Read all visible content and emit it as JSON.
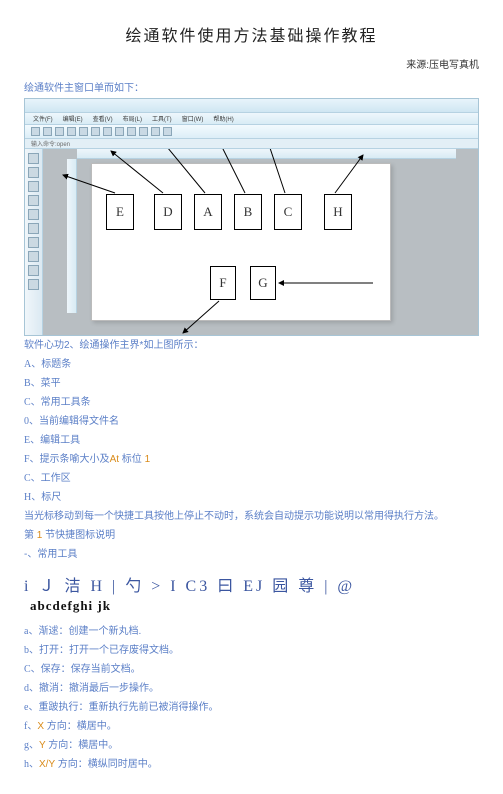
{
  "title": "绘通软件使用方法基础操作教程",
  "source_label": "来源:压电写真机",
  "lead": "绘通软件主窗口单而如下：",
  "screenshot": {
    "menu": [
      "文件(F)",
      "编辑(E)",
      "查看(V)",
      "布局(L)",
      "工具(T)",
      "窗口(W)",
      "帮助(H)"
    ],
    "status": "输入命令:open",
    "boxes": {
      "E": "E",
      "D": "D",
      "A": "A",
      "B": "B",
      "C": "C",
      "H": "H",
      "F": "F",
      "G": "G"
    }
  },
  "caption": "软件心功2、绘通操作主界*如上图所示：",
  "legend": [
    {
      "lbl": "A、",
      "txt": "标题条"
    },
    {
      "lbl": "B、",
      "txt": "菜平"
    },
    {
      "lbl": "C、",
      "txt": "常用工具条"
    },
    {
      "lbl": "0、",
      "txt": "当前编辑得文件名"
    },
    {
      "lbl": "E、",
      "txt": "编辑工具"
    },
    {
      "lbl": "F、",
      "txt": "提示条喻大小及",
      "orange": "At",
      "tail": " 标位 ",
      "orange2": "1"
    },
    {
      "lbl": "C、",
      "txt": "工作区"
    },
    {
      "lbl": "H、",
      "txt": "标尺"
    }
  ],
  "note1_a": "当光标移动到每一个快捷工具按他上停止不动时，系统会自动提示功能说明以常用得执行方法。",
  "note2_pre": "第 ",
  "note2_num": "1",
  "note2_post": " 节快捷图标说明",
  "note3": "-、常用工具",
  "glyphline": "i Ｊ 洁 H | 勺 > I  C3 曰 EJ 园 尊 | @",
  "glyphline2": "abcdefghi jk",
  "ops": [
    {
      "lbl": "a、",
      "txt": "渐逑：创建一个新丸档."
    },
    {
      "lbl": "b、",
      "txt": "打开：打开一个已存废得文档。"
    },
    {
      "lbl": "C、",
      "txt": "保存：保存当前文档。"
    },
    {
      "lbl": "d、",
      "txt": "撤消：撤消最后一步操作。"
    },
    {
      "lbl": "e、",
      "txt": "重跛执行：重新执行先前已被消得操作。"
    },
    {
      "lbl": "f、",
      "pre": "",
      "orange": "X",
      "txt": " 方向：横居中。"
    },
    {
      "lbl": "g、",
      "pre": "",
      "orange": "Y",
      "txt": " 方向：横居中。"
    },
    {
      "lbl": "h、",
      "pre": "",
      "orange": "X/Y",
      "txt": " 方向：横纵同时居中。"
    }
  ]
}
